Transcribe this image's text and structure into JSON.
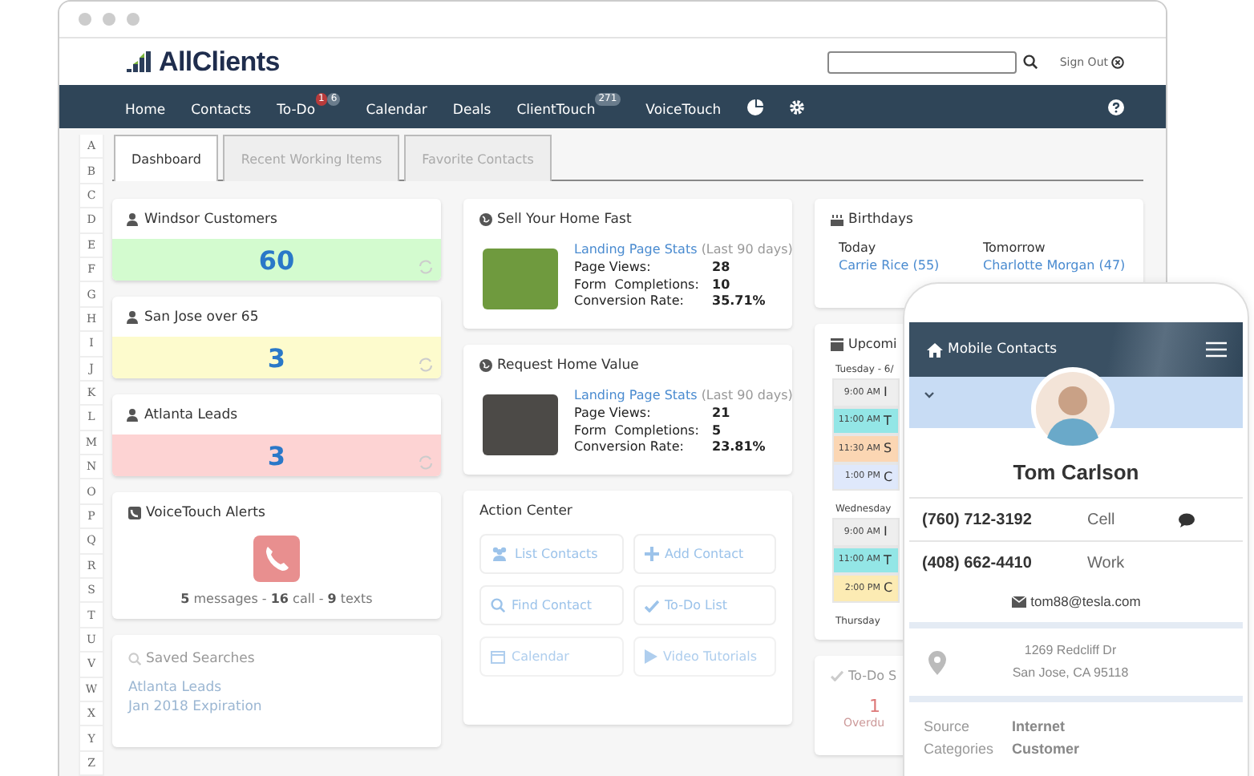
{
  "header": {
    "logo": "AllClients",
    "sign_out": "Sign Out"
  },
  "nav": [
    {
      "label": "Home"
    },
    {
      "label": "Contacts"
    },
    {
      "label": "To-Do",
      "badges": [
        {
          "text": "1",
          "kind": "alert"
        },
        {
          "text": "6",
          "kind": "count"
        }
      ]
    },
    {
      "label": "Calendar"
    },
    {
      "label": "Deals"
    },
    {
      "label": "ClientTouch",
      "badges": [
        {
          "text": "271",
          "kind": "count"
        }
      ]
    },
    {
      "label": "VoiceTouch"
    }
  ],
  "alphabet": [
    "A",
    "B",
    "C",
    "D",
    "E",
    "F",
    "G",
    "H",
    "I",
    "J",
    "K",
    "L",
    "M",
    "N",
    "O",
    "P",
    "Q",
    "R",
    "S",
    "T",
    "U",
    "V",
    "W",
    "X",
    "Y",
    "Z"
  ],
  "tabs": [
    {
      "label": "Dashboard",
      "selected": true
    },
    {
      "label": "Recent Working Items",
      "selected": false
    },
    {
      "label": "Favorite Contacts",
      "selected": false
    }
  ],
  "saved_lists": [
    {
      "title": "Windsor Customers",
      "count": "60",
      "color": "#d3fbcf"
    },
    {
      "title": "San Jose over 65",
      "count": "3",
      "color": "#fdfbcd"
    },
    {
      "title": "Atlanta Leads",
      "count": "3",
      "color": "#fdd3d3"
    }
  ],
  "voicetouch": {
    "title": "VoiceTouch Alerts",
    "summary": "**5** messages - **16** call - **9** texts"
  },
  "saved_searches": {
    "title": "Saved Searches",
    "items": [
      "Atlanta Leads",
      "Jan 2018 Expiration"
    ]
  },
  "landing_pages": [
    {
      "title": "Sell Your Home Fast",
      "link": "Landing Page Stats",
      "period": "(Last 90 days)",
      "stats": [
        {
          "label": "Page Views:",
          "value": "28"
        },
        {
          "label": "Form  Completions:",
          "value": "10"
        },
        {
          "label": "Conversion Rate:",
          "value": "35.71%"
        }
      ]
    },
    {
      "title": "Request Home Value",
      "link": "Landing Page Stats",
      "period": "(Last 90 days)",
      "stats": [
        {
          "label": "Page Views:",
          "value": "21"
        },
        {
          "label": "Form  Completions:",
          "value": "5"
        },
        {
          "label": "Conversion Rate:",
          "value": "23.81%"
        }
      ]
    }
  ],
  "action_center": {
    "title": "Action Center",
    "buttons": [
      {
        "label": "List Contacts",
        "kind": "people"
      },
      {
        "label": "Add Contact",
        "kind": "plus"
      },
      {
        "label": "Find Contact",
        "kind": "search"
      },
      {
        "label": "To-Do List",
        "kind": "check"
      },
      {
        "label": "Calendar",
        "kind": "calendar"
      },
      {
        "label": "Video Tutorials",
        "kind": "play"
      }
    ]
  },
  "birthdays": {
    "title": "Birthdays",
    "columns": [
      {
        "heading": "Today",
        "name": "Carrie Rice (55)"
      },
      {
        "heading": "Tomorrow",
        "name": "Charlotte Morgan (47)"
      }
    ]
  },
  "calendar": {
    "title": "Upcomi",
    "days": [
      {
        "label": "Tuesday - 6/",
        "events": [
          {
            "time": "9:00 AM",
            "text": "I",
            "color": "#eeeeee"
          },
          {
            "time": "11:00 AM",
            "text": "T",
            "color": "#93e6e6"
          },
          {
            "time": "11:30 AM",
            "text": "S",
            "color": "#fbd6b3"
          },
          {
            "time": "1:00 PM",
            "text": "C",
            "color": "#dfe8fb"
          }
        ]
      },
      {
        "label": "Wednesday",
        "events": [
          {
            "time": "9:00 AM",
            "text": "I",
            "color": "#eeeeee"
          },
          {
            "time": "11:00 AM",
            "text": "T",
            "color": "#93e6e6"
          },
          {
            "time": "2:00 PM",
            "text": "C",
            "color": "#fcebb3"
          }
        ]
      },
      {
        "label": "Thursday"
      }
    ]
  },
  "todo": {
    "title": "To-Do S",
    "count": "1",
    "label": "Overdu"
  },
  "phone": {
    "title": "Mobile Contacts",
    "name": "Tom Carlson",
    "numbers": [
      {
        "number": "(760) 712-3192",
        "type": "Cell",
        "sms": true
      },
      {
        "number": "(408) 662-4410",
        "type": "Work",
        "sms": false
      }
    ],
    "email": "tom88@tesla.com",
    "address": [
      "1269 Redcliff Dr",
      "San Jose, CA 95118"
    ],
    "details": [
      {
        "label": "Source",
        "value": "Internet"
      },
      {
        "label": "Categories",
        "value": "Customer"
      }
    ]
  }
}
